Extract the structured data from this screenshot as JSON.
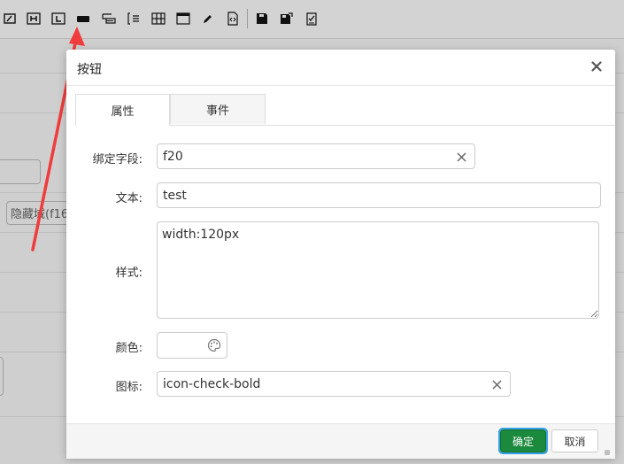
{
  "toolbar": {
    "items": [
      {
        "icon": "textbox-icon"
      },
      {
        "icon": "heading-icon",
        "glyph": "H"
      },
      {
        "icon": "label-icon",
        "glyph": "L"
      },
      {
        "icon": "button-icon"
      },
      {
        "icon": "table-form-icon"
      },
      {
        "icon": "bracket-list-icon"
      },
      {
        "icon": "grid-icon"
      },
      {
        "icon": "window-icon"
      },
      {
        "icon": "pencil-icon"
      },
      {
        "icon": "code-file-icon"
      },
      {
        "icon": "save-icon"
      },
      {
        "icon": "save-as-icon"
      },
      {
        "icon": "checklist-icon"
      }
    ]
  },
  "background": {
    "hidden_field_label": "隐藏域(f16"
  },
  "dialog": {
    "title": "按钮",
    "tabs": [
      {
        "label": "属性",
        "active": true
      },
      {
        "label": "事件",
        "active": false
      }
    ],
    "form": {
      "bind_field": {
        "label": "绑定字段:",
        "value": "f20"
      },
      "text": {
        "label": "文本:",
        "value": "test"
      },
      "style": {
        "label": "样式:",
        "value": "width:120px"
      },
      "color": {
        "label": "颜色:",
        "value": ""
      },
      "icon": {
        "label": "图标:",
        "value": "icon-check-bold"
      }
    },
    "footer": {
      "ok_label": "确定",
      "cancel_label": "取消"
    }
  },
  "colors": {
    "primary": "#1c8a3c",
    "focus_ring": "#36a3e8",
    "annotation_arrow": "#f03c3c"
  }
}
